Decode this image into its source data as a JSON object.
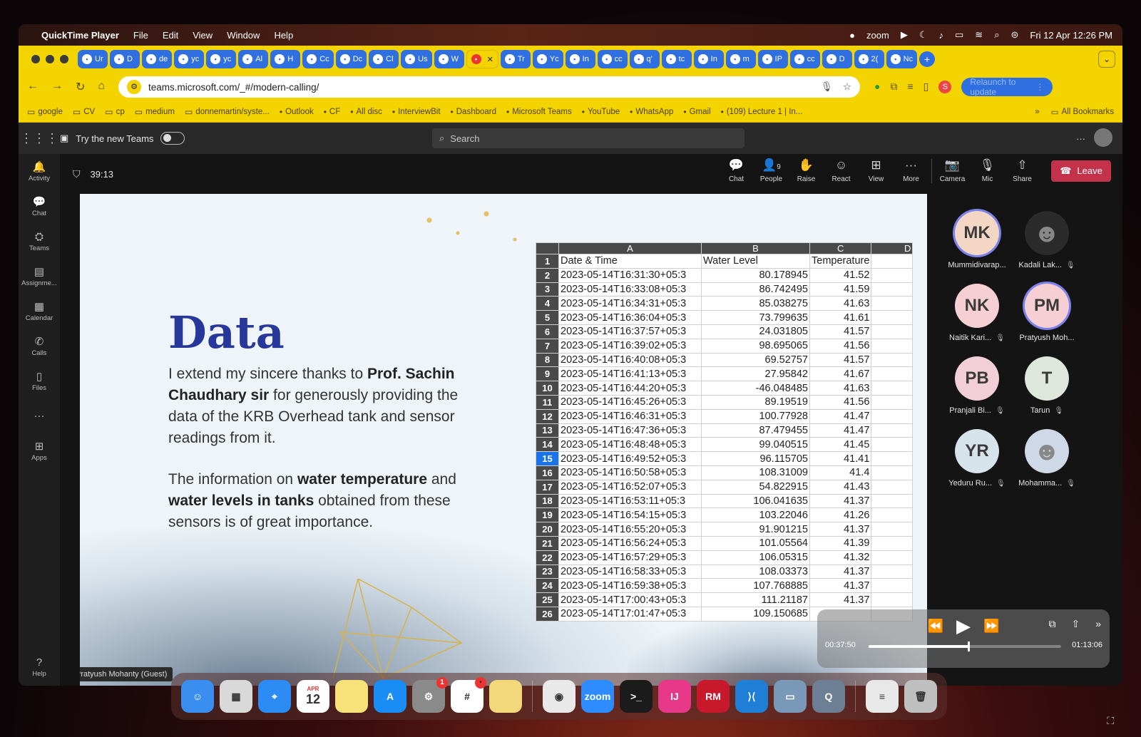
{
  "menubar": {
    "app": "QuickTime Player",
    "items": [
      "File",
      "Edit",
      "View",
      "Window",
      "Help"
    ],
    "zoom_label": "zoom",
    "datetime": "Fri 12 Apr  12:26 PM"
  },
  "browser": {
    "tabs": [
      {
        "label": "Ur",
        "icon": "list-icon"
      },
      {
        "label": "D",
        "icon": "app-icon"
      },
      {
        "label": "de",
        "icon": "github-icon"
      },
      {
        "label": "yc",
        "icon": "github-icon"
      },
      {
        "label": "yc",
        "icon": "github-icon"
      },
      {
        "label": "Al",
        "icon": "ai-icon"
      },
      {
        "label": "H",
        "icon": "github-icon"
      },
      {
        "label": "Cc",
        "icon": "teams-icon"
      },
      {
        "label": "Dc",
        "icon": "teams-icon"
      },
      {
        "label": "Cl",
        "icon": "ai-icon"
      },
      {
        "label": "Us",
        "icon": "github-icon"
      },
      {
        "label": "W",
        "icon": "whatsapp-icon"
      },
      {
        "label": "",
        "icon": "record-icon",
        "active": true
      },
      {
        "label": "Tr",
        "icon": "teams-icon"
      },
      {
        "label": "Yc",
        "icon": "grid-icon"
      },
      {
        "label": "In",
        "icon": "teams-icon"
      },
      {
        "label": "cc",
        "icon": "app-icon"
      },
      {
        "label": "q'",
        "icon": "app-icon"
      },
      {
        "label": "tc",
        "icon": "app-icon"
      },
      {
        "label": "In",
        "icon": "instagram-icon"
      },
      {
        "label": "m",
        "icon": "google-icon"
      },
      {
        "label": "IP",
        "icon": "app-icon"
      },
      {
        "label": "cc",
        "icon": "app-icon"
      },
      {
        "label": "D",
        "icon": "app-icon"
      },
      {
        "label": "2(",
        "icon": "app-icon"
      },
      {
        "label": "Nc",
        "icon": "app-icon"
      }
    ],
    "url": "teams.microsoft.com/_#/modern-calling/",
    "relaunch_label": "Relaunch to update",
    "profile_initial": "S",
    "bookmarks": [
      "google",
      "CV",
      "cp",
      "medium",
      "donnemartin/syste...",
      "Outlook",
      "CF",
      "All disc",
      "InterviewBit",
      "Dashboard",
      "Microsoft Teams",
      "YouTube",
      "WhatsApp",
      "Gmail",
      "(109) Lecture 1 | In..."
    ],
    "all_bookmarks": "All Bookmarks"
  },
  "teams": {
    "try_new": "Try the new Teams",
    "search_placeholder": "Search",
    "rail": [
      {
        "label": "Activity",
        "icon": "bell-icon"
      },
      {
        "label": "Chat",
        "icon": "chat-icon"
      },
      {
        "label": "Teams",
        "icon": "teams-icon"
      },
      {
        "label": "Assignme...",
        "icon": "assignments-icon"
      },
      {
        "label": "Calendar",
        "icon": "calendar-icon"
      },
      {
        "label": "Calls",
        "icon": "phone-icon"
      },
      {
        "label": "Files",
        "icon": "file-icon"
      },
      {
        "label": "...",
        "icon": "more-icon"
      },
      {
        "label": "Apps",
        "icon": "apps-icon"
      }
    ],
    "help_label": "Help",
    "timer": "39:13",
    "controls": {
      "chat": "Chat",
      "people": "People",
      "people_count": "9",
      "raise": "Raise",
      "react": "React",
      "view": "View",
      "more": "More",
      "camera": "Camera",
      "mic": "Mic",
      "share": "Share",
      "leave": "Leave"
    },
    "presenter_label": "Pratyush Mohanty (Guest)",
    "participants": [
      {
        "initials": "MK",
        "name": "Mummidivarap...",
        "color": "#f3d7c4",
        "ring": true,
        "muted": false
      },
      {
        "initials": "",
        "name": "Kadali Lak...",
        "color": "#2b2b2b",
        "ring": false,
        "muted": true,
        "photo": true
      },
      {
        "initials": "NK",
        "name": "Naitik Kari...",
        "color": "#f6cfd4",
        "ring": false,
        "muted": true
      },
      {
        "initials": "PM",
        "name": "Pratyush Moh...",
        "color": "#f6cfd4",
        "ring": true,
        "muted": false
      },
      {
        "initials": "PB",
        "name": "Pranjali Bi...",
        "color": "#f2cfd8",
        "ring": false,
        "muted": true
      },
      {
        "initials": "T",
        "name": "Tarun",
        "color": "#dfe6dc",
        "ring": false,
        "muted": true
      },
      {
        "initials": "YR",
        "name": "Yeduru Ru...",
        "color": "#d6e3ea",
        "ring": false,
        "muted": true
      },
      {
        "initials": "",
        "name": "Mohamma...",
        "color": "#cfd8e6",
        "ring": false,
        "muted": true,
        "photo": true
      }
    ]
  },
  "slide": {
    "title": "Data",
    "para1_pre": "I extend my sincere thanks to ",
    "para1_bold": "Prof. Sachin Chaudhary sir",
    "para1_post": " for generously providing the data of the KRB Overhead tank and sensor readings from it.",
    "para2_pre": "The information on ",
    "para2_bold1": "water temperature",
    "para2_mid": " and ",
    "para2_bold2": "water levels in tanks",
    "para2_post": " obtained from these sensors is of great importance.",
    "sheet": {
      "columns": [
        "A",
        "B",
        "C",
        "D"
      ],
      "header": [
        "Date & Time",
        "Water Level",
        "Temperature",
        ""
      ],
      "selected_row": 15,
      "rows": [
        [
          "2023-05-14T16:31:30+05:3",
          "80.178945",
          "41.52"
        ],
        [
          "2023-05-14T16:33:08+05:3",
          "86.742495",
          "41.59"
        ],
        [
          "2023-05-14T16:34:31+05:3",
          "85.038275",
          "41.63"
        ],
        [
          "2023-05-14T16:36:04+05:3",
          "73.799635",
          "41.61"
        ],
        [
          "2023-05-14T16:37:57+05:3",
          "24.031805",
          "41.57"
        ],
        [
          "2023-05-14T16:39:02+05:3",
          "98.695065",
          "41.56"
        ],
        [
          "2023-05-14T16:40:08+05:3",
          "69.52757",
          "41.57"
        ],
        [
          "2023-05-14T16:41:13+05:3",
          "27.95842",
          "41.67"
        ],
        [
          "2023-05-14T16:44:20+05:3",
          "-46.048485",
          "41.63"
        ],
        [
          "2023-05-14T16:45:26+05:3",
          "89.19519",
          "41.56"
        ],
        [
          "2023-05-14T16:46:31+05:3",
          "100.77928",
          "41.47"
        ],
        [
          "2023-05-14T16:47:36+05:3",
          "87.479455",
          "41.47"
        ],
        [
          "2023-05-14T16:48:48+05:3",
          "99.040515",
          "41.45"
        ],
        [
          "2023-05-14T16:49:52+05:3",
          "96.115705",
          "41.41"
        ],
        [
          "2023-05-14T16:50:58+05:3",
          "108.31009",
          "41.4"
        ],
        [
          "2023-05-14T16:52:07+05:3",
          "54.822915",
          "41.43"
        ],
        [
          "2023-05-14T16:53:11+05:3",
          "106.041635",
          "41.37"
        ],
        [
          "2023-05-14T16:54:15+05:3",
          "103.22046",
          "41.26"
        ],
        [
          "2023-05-14T16:55:20+05:3",
          "91.901215",
          "41.37"
        ],
        [
          "2023-05-14T16:56:24+05:3",
          "101.05564",
          "41.39"
        ],
        [
          "2023-05-14T16:57:29+05:3",
          "106.05315",
          "41.32"
        ],
        [
          "2023-05-14T16:58:33+05:3",
          "108.03373",
          "41.37"
        ],
        [
          "2023-05-14T16:59:38+05:3",
          "107.768885",
          "41.37"
        ],
        [
          "2023-05-14T17:00:43+05:3",
          "111.21187",
          "41.37"
        ],
        [
          "2023-05-14T17:01:47+05:3",
          "109.150685",
          ""
        ]
      ]
    }
  },
  "player": {
    "elapsed": "00:37:50",
    "remaining": "01:13:06",
    "progress": 0.52
  },
  "dock": {
    "apps": [
      {
        "name": "finder",
        "label": "☺",
        "color": "#3a8ef0"
      },
      {
        "name": "launchpad",
        "label": "▦",
        "color": "#d9d9d9"
      },
      {
        "name": "safari",
        "label": "⌖",
        "color": "#2c8cf3"
      },
      {
        "name": "calendar",
        "label": "12",
        "month": "APR",
        "color": "#ffffff"
      },
      {
        "name": "notes",
        "label": "",
        "color": "#f7e27a"
      },
      {
        "name": "app-store",
        "label": "A",
        "color": "#1a8cf5"
      },
      {
        "name": "system-settings",
        "label": "⚙",
        "color": "#8a8a8a",
        "badge": "1"
      },
      {
        "name": "slack",
        "label": "#",
        "color": "#ffffff",
        "badge": "•"
      },
      {
        "name": "stickies",
        "label": "",
        "color": "#f2d87a"
      },
      {
        "name": "chrome",
        "label": "◉",
        "color": "#e9e9e9"
      },
      {
        "name": "zoom",
        "label": "zoom",
        "color": "#2d8cff"
      },
      {
        "name": "terminal",
        "label": ">_",
        "color": "#1b1b1b"
      },
      {
        "name": "intellij",
        "label": "IJ",
        "color": "#e8388a"
      },
      {
        "name": "rubymine",
        "label": "RM",
        "color": "#c8182c"
      },
      {
        "name": "vscode",
        "label": "⟩⟨",
        "color": "#1f7fd6"
      },
      {
        "name": "preview",
        "label": "▭",
        "color": "#7a98b8"
      },
      {
        "name": "quicktime",
        "label": "Q",
        "color": "#6c7f95"
      },
      {
        "name": "document",
        "label": "≡",
        "color": "#e8e8e8"
      },
      {
        "name": "trash",
        "label": "🗑",
        "color": "#bfbfbf"
      }
    ]
  }
}
